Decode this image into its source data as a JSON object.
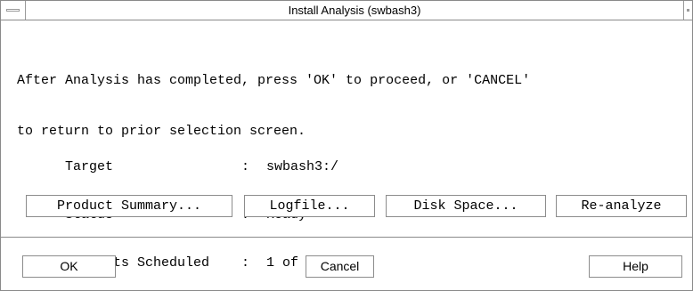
{
  "window": {
    "title": "Install Analysis (swbash3)"
  },
  "message": {
    "line1": "After Analysis has completed, press 'OK' to proceed, or 'CANCEL'",
    "line2": "to return to prior selection screen."
  },
  "info": [
    {
      "label": "Target",
      "value": "swbash3:/"
    },
    {
      "label": "Status",
      "value": "Ready"
    },
    {
      "label": "Products Scheduled",
      "value": "1 of 1"
    }
  ],
  "separator_char": ":",
  "actions": {
    "product_summary": "Product Summary...",
    "logfile": "Logfile...",
    "disk_space": "Disk Space...",
    "reanalyze": "Re-analyze"
  },
  "dialog_buttons": {
    "ok": "OK",
    "cancel": "Cancel",
    "help": "Help"
  }
}
